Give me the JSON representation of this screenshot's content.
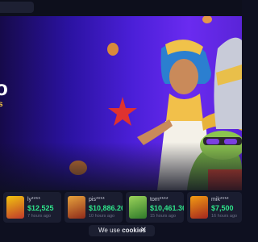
{
  "hero": {
    "headline_fragment": "o",
    "subtitle_fragment": "s"
  },
  "recent_wins": [
    {
      "user": "ly****",
      "amount": "$12,525",
      "time": "7 hours ago",
      "thumb_color": "#c0392b"
    },
    {
      "user": "pis****",
      "amount": "$10,886.26",
      "time": "10 hours ago",
      "thumb_color": "#8e2a1a"
    },
    {
      "user": "tom****",
      "amount": "$10,461.36",
      "time": "15 hours ago",
      "thumb_color": "#2f7a2a"
    },
    {
      "user": "mik****",
      "amount": "$7,500",
      "time": "16 hours ago",
      "thumb_color": "#a3261f"
    }
  ],
  "cookie_banner": {
    "prefix": "We use ",
    "highlight": "cookies"
  },
  "colors": {
    "win_green": "#2ee38a",
    "accent_gold": "#f5c542"
  }
}
